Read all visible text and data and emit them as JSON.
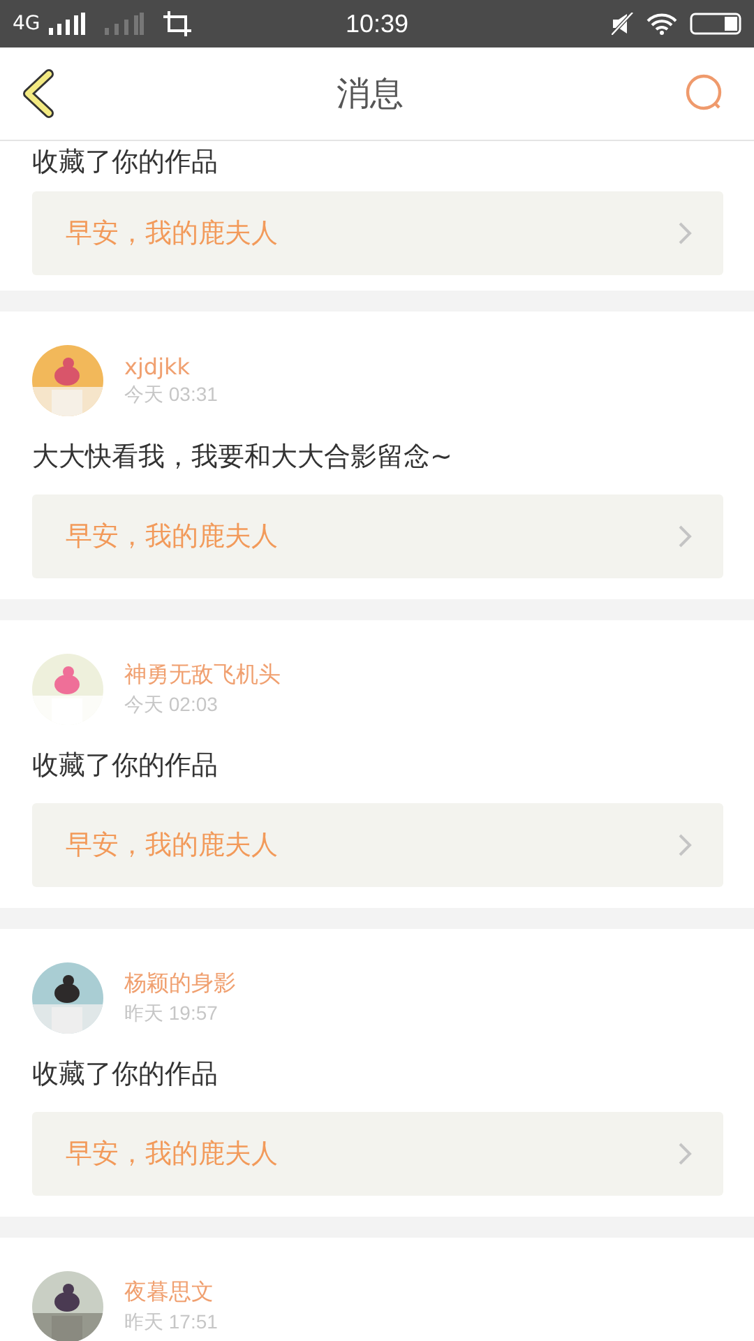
{
  "status_bar": {
    "network": "4G",
    "time": "10:39"
  },
  "header": {
    "title": "消息"
  },
  "messages": [
    {
      "text": "收藏了你的作品",
      "link": "早安，我的鹿夫人"
    },
    {
      "name": "xjdjkk",
      "time": "今天 03:31",
      "text": "大大快看我，我要和大大合影留念~",
      "link": "早安，我的鹿夫人"
    },
    {
      "name": "神勇无敌飞机头",
      "time": "今天 02:03",
      "text": "收藏了你的作品",
      "link": "早安，我的鹿夫人"
    },
    {
      "name": "杨颖的身影",
      "time": "昨天 19:57",
      "text": "收藏了你的作品",
      "link": "早安，我的鹿夫人"
    },
    {
      "name": "夜暮思文",
      "time": "昨天 17:51"
    }
  ]
}
